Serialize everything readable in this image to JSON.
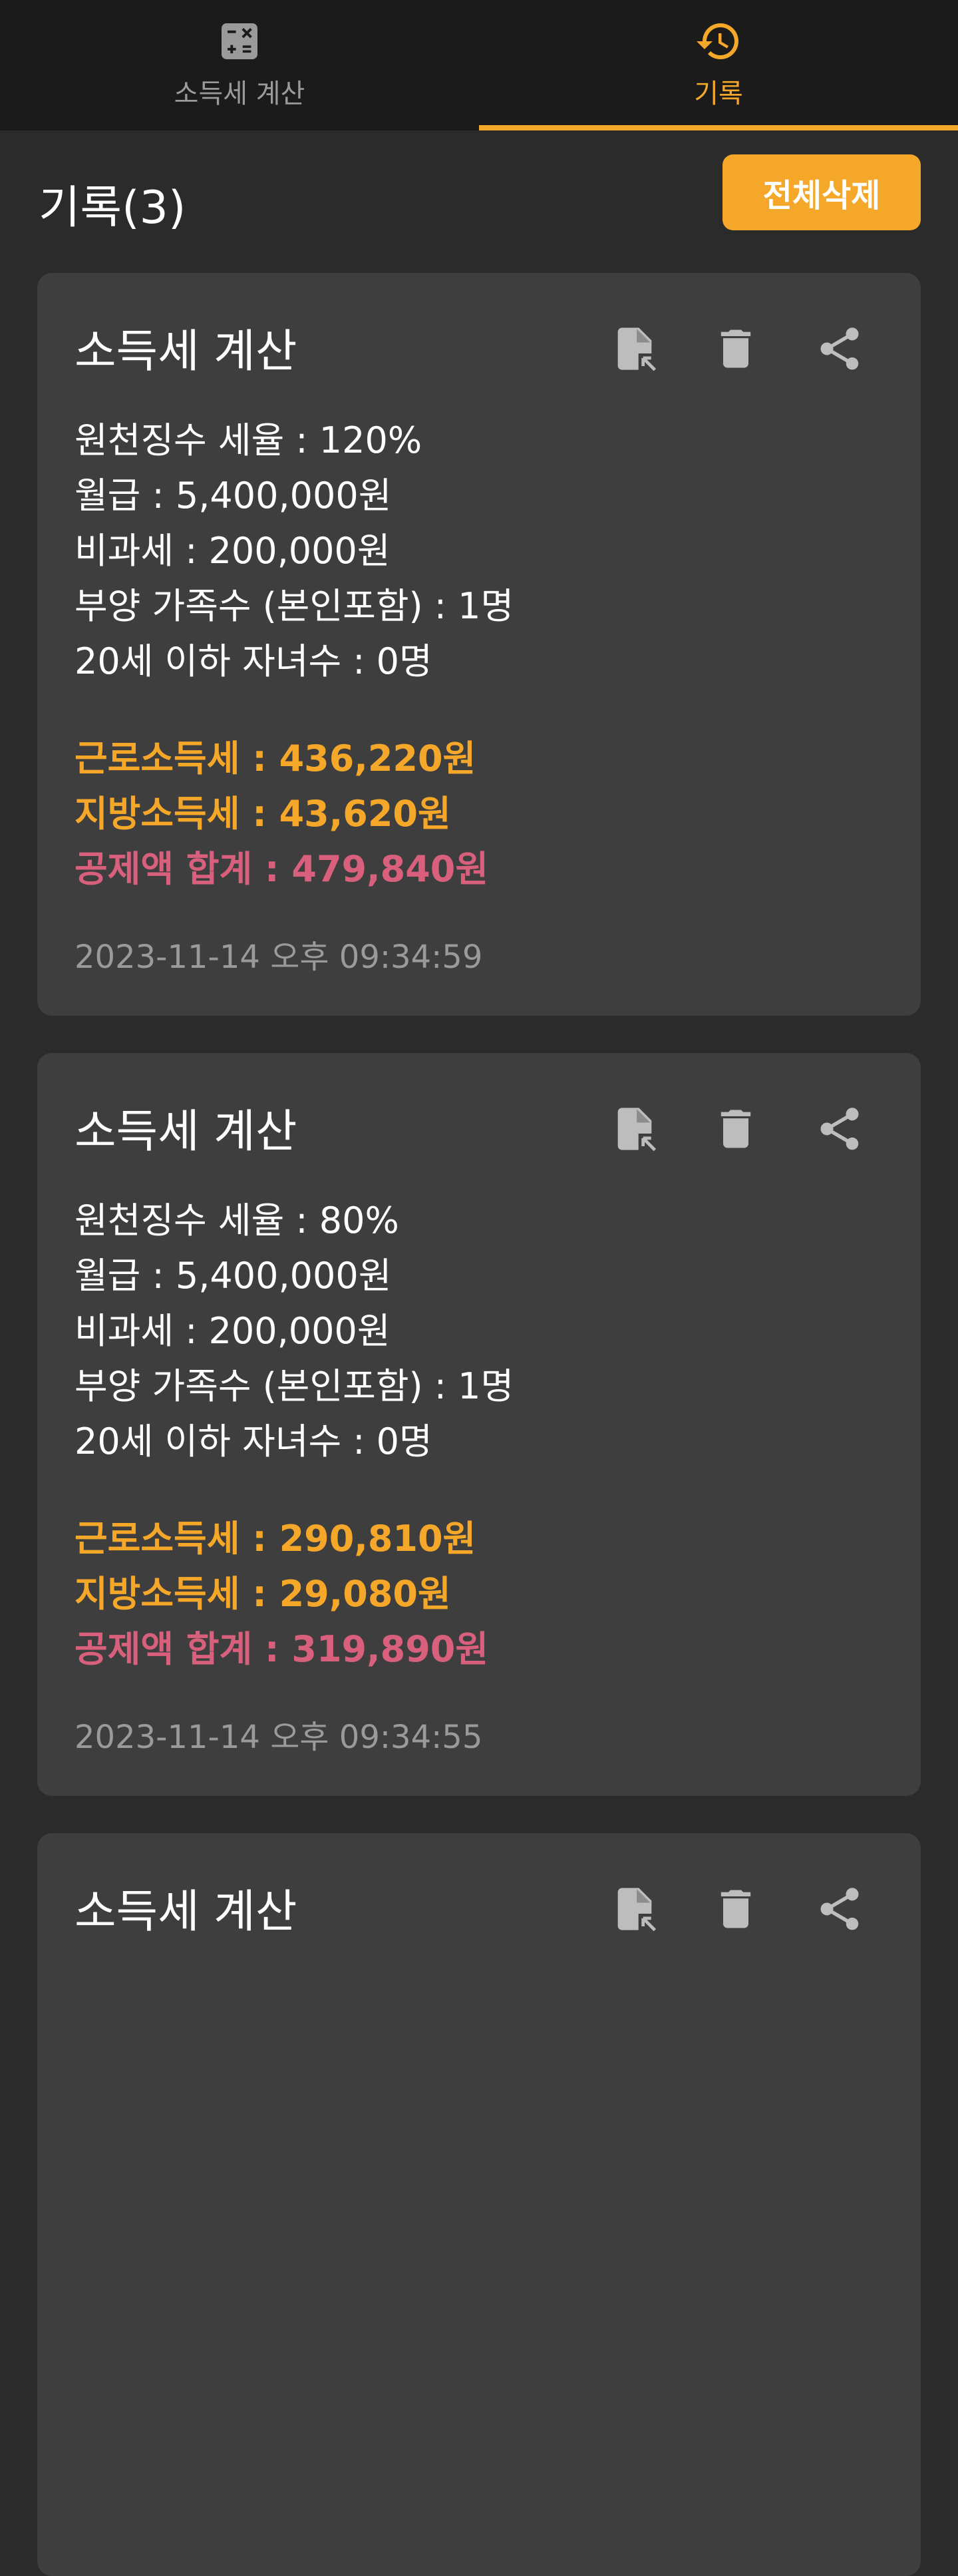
{
  "tabs": [
    {
      "label": "소득세 계산",
      "icon": "calculator-icon",
      "active": false
    },
    {
      "label": "기록",
      "icon": "history-icon",
      "active": true
    }
  ],
  "colors": {
    "accent": "#f5a72a",
    "total": "#d9607d",
    "card": "#3e3e3e",
    "background": "#2b2b2b",
    "tabbar": "#1b1b1b"
  },
  "header": {
    "title": "기록(3)",
    "clear_all_label": "전체삭제"
  },
  "records": [
    {
      "title": "소득세 계산",
      "details": [
        "원천징수 세율 : 120%",
        "월급 : 5,400,000원",
        "비과세 : 200,000원",
        "부양 가족수 (본인포함) : 1명",
        "20세 이하 자녀수 : 0명"
      ],
      "income_tax": "근로소득세 : 436,220원",
      "local_tax": "지방소득세 : 43,620원",
      "total": "공제액 합계 : 479,840원",
      "timestamp": "2023-11-14 오후 09:34:59"
    },
    {
      "title": "소득세 계산",
      "details": [
        "원천징수 세율 : 80%",
        "월급 : 5,400,000원",
        "비과세 : 200,000원",
        "부양 가족수 (본인포함) : 1명",
        "20세 이하 자녀수 : 0명"
      ],
      "income_tax": "근로소득세 : 290,810원",
      "local_tax": "지방소득세 : 29,080원",
      "total": "공제액 합계 : 319,890원",
      "timestamp": "2023-11-14 오후 09:34:55"
    },
    {
      "title": "소득세 계산"
    }
  ]
}
